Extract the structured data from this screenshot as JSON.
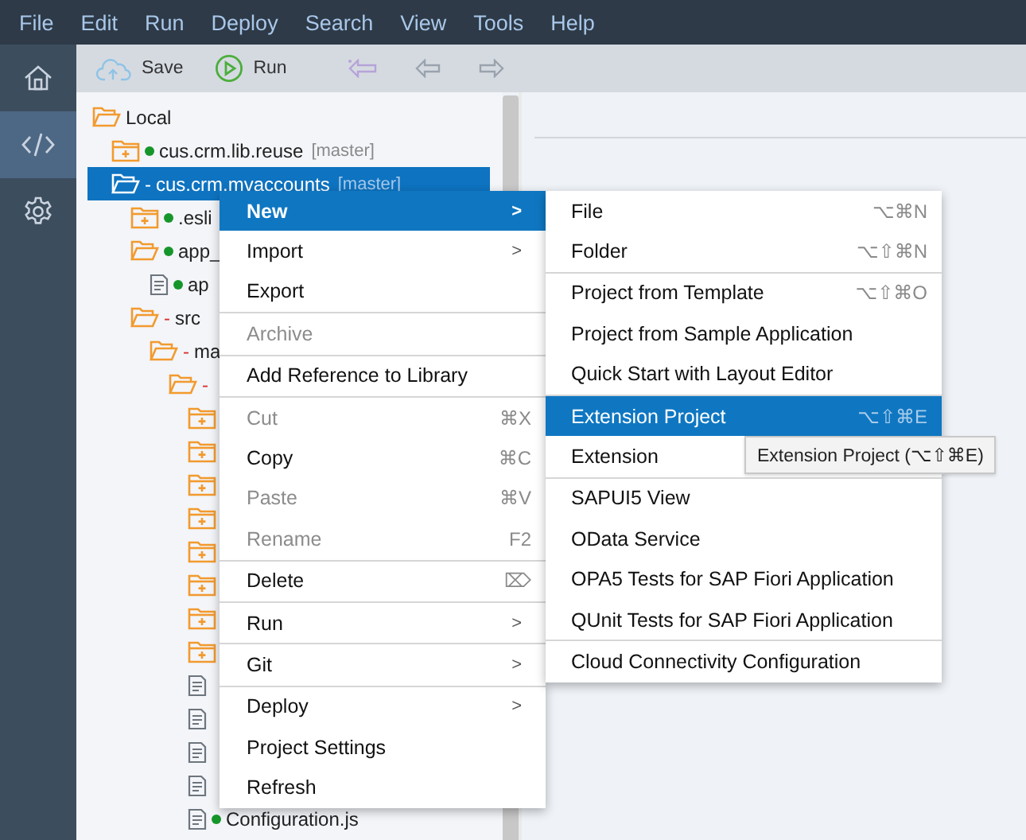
{
  "menubar": [
    {
      "label": "File"
    },
    {
      "label": "Edit"
    },
    {
      "label": "Run"
    },
    {
      "label": "Deploy"
    },
    {
      "label": "Search"
    },
    {
      "label": "View"
    },
    {
      "label": "Tools"
    },
    {
      "label": "Help"
    }
  ],
  "rail": [
    {
      "kind": "home",
      "selected": false
    },
    {
      "kind": "code",
      "selected": true
    },
    {
      "kind": "settings",
      "selected": false
    }
  ],
  "toolbar": [
    {
      "kind": "save",
      "label": "Save"
    },
    {
      "kind": "run",
      "label": "Run"
    },
    {
      "kind": "back-marked"
    },
    {
      "kind": "back"
    },
    {
      "kind": "forward"
    }
  ],
  "tree": [
    {
      "kind": "folder-open",
      "label": "Local",
      "selected": false,
      "children": [
        {
          "kind": "folder-plus",
          "git_dot": true,
          "label": "cus.crm.lib.reuse",
          "suffix": "[master]",
          "selected": false
        },
        {
          "kind": "folder-open",
          "prefix": "-",
          "label": "cus.crm.mvaccounts",
          "suffix": "[master]",
          "selected": true,
          "children": [
            {
              "kind": "folder-plus",
              "git_dot": true,
              "label": ".esli",
              "selected": false
            },
            {
              "kind": "folder-open",
              "git_dot": true,
              "label": "app_",
              "selected": false,
              "children": [
                {
                  "kind": "file",
                  "git_dot": true,
                  "label": "ap",
                  "selected": false
                }
              ]
            },
            {
              "kind": "folder-open",
              "prefix": "-",
              "label": "src",
              "selected": false,
              "children": [
                {
                  "kind": "folder-open",
                  "prefix": "-",
                  "label": "ma",
                  "selected": false,
                  "children": [
                    {
                      "kind": "folder-open",
                      "prefix": "-",
                      "selected": false,
                      "children": [
                        {
                          "kind": "folder-plus",
                          "selected": false
                        },
                        {
                          "kind": "folder-plus",
                          "selected": false
                        },
                        {
                          "kind": "folder-plus",
                          "selected": false
                        },
                        {
                          "kind": "folder-plus",
                          "selected": false
                        },
                        {
                          "kind": "folder-plus",
                          "selected": false
                        },
                        {
                          "kind": "folder-plus",
                          "selected": false
                        },
                        {
                          "kind": "folder-plus",
                          "selected": false
                        },
                        {
                          "kind": "folder-plus",
                          "selected": false
                        },
                        {
                          "kind": "file",
                          "selected": false
                        },
                        {
                          "kind": "file",
                          "selected": false
                        },
                        {
                          "kind": "file",
                          "selected": false
                        },
                        {
                          "kind": "file",
                          "selected": false
                        },
                        {
                          "kind": "file",
                          "git_dot": true,
                          "label": "Configuration.js",
                          "selected": false
                        }
                      ]
                    }
                  ]
                }
              ]
            }
          ]
        }
      ]
    }
  ],
  "context_menu": [
    {
      "kind": "item",
      "label": "New",
      "arrow": ">",
      "selected": true,
      "disabled": false
    },
    {
      "kind": "item",
      "label": "Import",
      "arrow": ">",
      "selected": false,
      "disabled": false
    },
    {
      "kind": "item",
      "label": "Export",
      "selected": false,
      "disabled": false
    },
    {
      "kind": "divider"
    },
    {
      "kind": "item",
      "label": "Archive",
      "selected": false,
      "disabled": true
    },
    {
      "kind": "divider"
    },
    {
      "kind": "item",
      "label": "Add Reference to Library",
      "selected": false,
      "disabled": false
    },
    {
      "kind": "divider"
    },
    {
      "kind": "item",
      "label": "Cut",
      "shortcut": "⌘X",
      "selected": false,
      "disabled": true
    },
    {
      "kind": "item",
      "label": "Copy",
      "shortcut": "⌘C",
      "selected": false,
      "disabled": false
    },
    {
      "kind": "item",
      "label": "Paste",
      "shortcut": "⌘V",
      "selected": false,
      "disabled": true
    },
    {
      "kind": "item",
      "label": "Rename",
      "shortcut": "F2",
      "selected": false,
      "disabled": true
    },
    {
      "kind": "divider"
    },
    {
      "kind": "item",
      "label": "Delete",
      "shortcut": "⌦",
      "selected": false,
      "disabled": false
    },
    {
      "kind": "divider"
    },
    {
      "kind": "item",
      "label": "Run",
      "arrow": ">",
      "selected": false,
      "disabled": false
    },
    {
      "kind": "divider"
    },
    {
      "kind": "item",
      "label": "Git",
      "arrow": ">",
      "selected": false,
      "disabled": false
    },
    {
      "kind": "divider"
    },
    {
      "kind": "item",
      "label": "Deploy",
      "arrow": ">",
      "selected": false,
      "disabled": false
    },
    {
      "kind": "item",
      "label": "Project Settings",
      "selected": false,
      "disabled": false
    },
    {
      "kind": "item",
      "label": "Refresh",
      "selected": false,
      "disabled": false
    }
  ],
  "submenu": [
    {
      "kind": "item",
      "label": "File",
      "shortcut": "⌥⌘N",
      "selected": false
    },
    {
      "kind": "item",
      "label": "Folder",
      "shortcut": "⌥⇧⌘N",
      "selected": false
    },
    {
      "kind": "divider"
    },
    {
      "kind": "item",
      "label": "Project from Template",
      "shortcut": "⌥⇧⌘O",
      "selected": false
    },
    {
      "kind": "item",
      "label": "Project from Sample Application",
      "selected": false
    },
    {
      "kind": "item",
      "label": "Quick Start with Layout Editor",
      "selected": false
    },
    {
      "kind": "divider"
    },
    {
      "kind": "item",
      "label": "Extension Project",
      "shortcut": "⌥⇧⌘E",
      "selected": true
    },
    {
      "kind": "item",
      "label": "Extension",
      "selected": false
    },
    {
      "kind": "divider"
    },
    {
      "kind": "item",
      "label": "SAPUI5 View",
      "selected": false
    },
    {
      "kind": "item",
      "label": "OData Service",
      "selected": false
    },
    {
      "kind": "item",
      "label": "OPA5 Tests for SAP Fiori Application",
      "selected": false
    },
    {
      "kind": "item",
      "label": "QUnit Tests for SAP Fiori Application",
      "selected": false
    },
    {
      "kind": "divider"
    },
    {
      "kind": "item",
      "label": "Cloud Connectivity Configuration",
      "selected": false
    }
  ],
  "tooltip": {
    "text": "Extension Project (⌥⇧⌘E)"
  }
}
